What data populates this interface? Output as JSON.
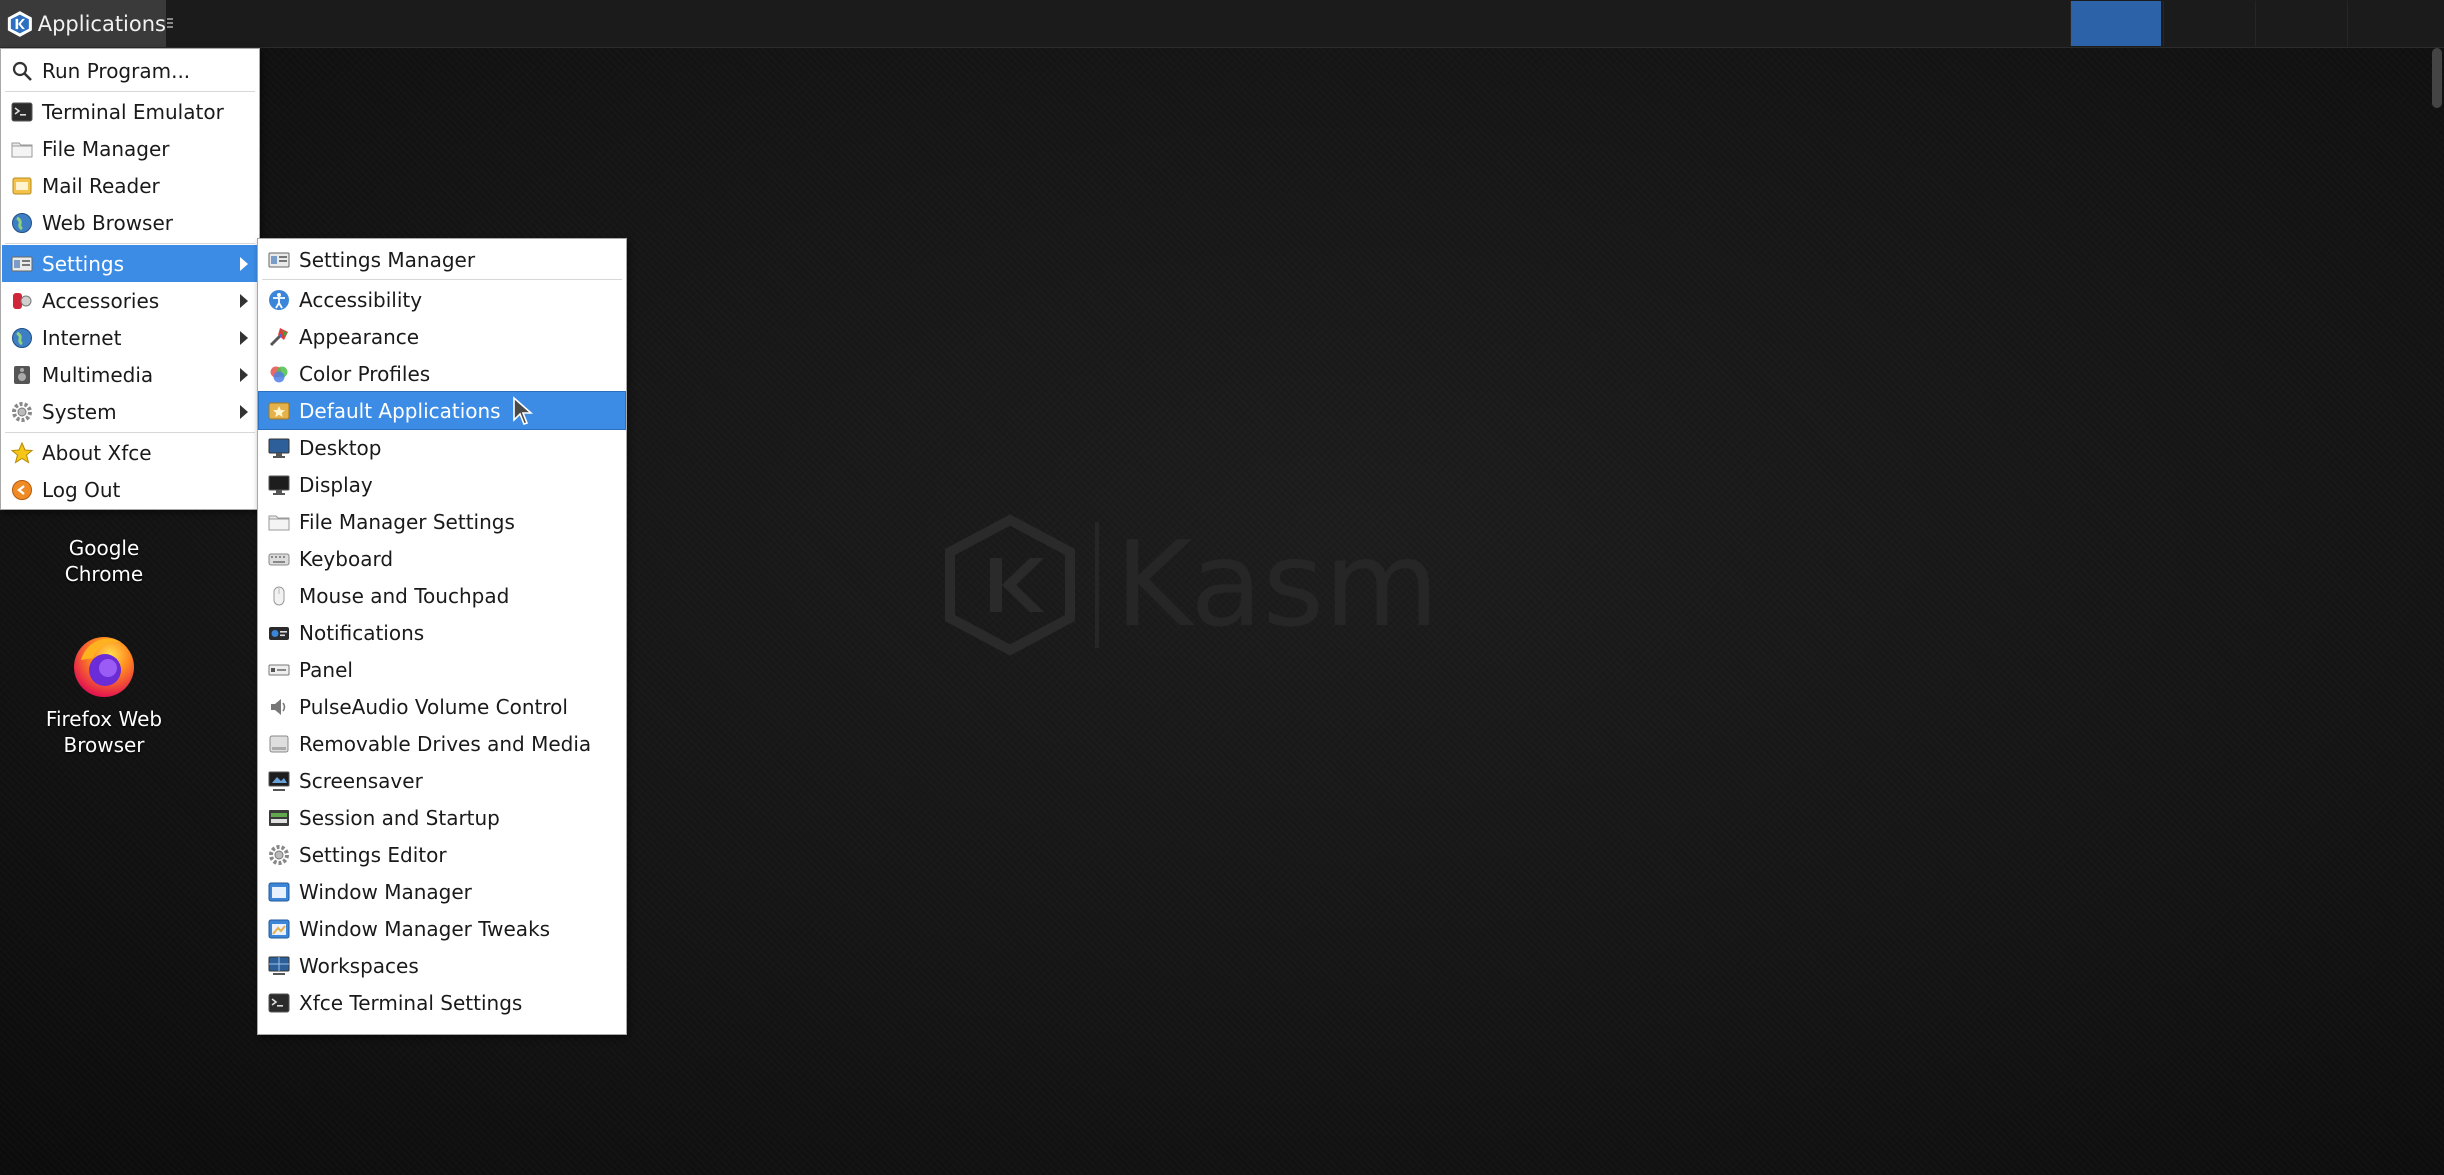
{
  "panel": {
    "apps_label": "Applications",
    "accent_color": "#2c63a8"
  },
  "desktop": {
    "chrome_label": "Google\nChrome",
    "firefox_label": "Firefox Web\nBrowser",
    "watermark": "Kasm"
  },
  "main_menu": {
    "items": [
      {
        "label": "Run Program...",
        "icon": "search-icon"
      },
      {
        "label": "Terminal Emulator",
        "icon": "terminal-icon"
      },
      {
        "label": "File Manager",
        "icon": "folder-icon"
      },
      {
        "label": "Mail Reader",
        "icon": "mail-icon"
      },
      {
        "label": "Web Browser",
        "icon": "globe-icon"
      },
      {
        "label": "Settings",
        "icon": "settings-icon"
      },
      {
        "label": "Accessories",
        "icon": "accessories-icon"
      },
      {
        "label": "Internet",
        "icon": "globe-icon"
      },
      {
        "label": "Multimedia",
        "icon": "multimedia-icon"
      },
      {
        "label": "System",
        "icon": "gear-icon"
      },
      {
        "label": "About Xfce",
        "icon": "star-icon"
      },
      {
        "label": "Log Out",
        "icon": "logout-icon"
      }
    ]
  },
  "settings_menu": {
    "items": [
      {
        "label": "Settings Manager",
        "icon": "settings-manager-icon"
      },
      {
        "label": "Accessibility",
        "icon": "accessibility-icon"
      },
      {
        "label": "Appearance",
        "icon": "appearance-icon"
      },
      {
        "label": "Color Profiles",
        "icon": "color-profiles-icon"
      },
      {
        "label": "Default Applications",
        "icon": "default-applications-icon"
      },
      {
        "label": "Desktop",
        "icon": "desktop-icon"
      },
      {
        "label": "Display",
        "icon": "display-icon"
      },
      {
        "label": "File Manager Settings",
        "icon": "folder-icon"
      },
      {
        "label": "Keyboard",
        "icon": "keyboard-icon"
      },
      {
        "label": "Mouse and Touchpad",
        "icon": "mouse-icon"
      },
      {
        "label": "Notifications",
        "icon": "notifications-icon"
      },
      {
        "label": "Panel",
        "icon": "panel-icon"
      },
      {
        "label": "PulseAudio Volume Control",
        "icon": "speaker-icon"
      },
      {
        "label": "Removable Drives and Media",
        "icon": "drive-icon"
      },
      {
        "label": "Screensaver",
        "icon": "screensaver-icon"
      },
      {
        "label": "Session and Startup",
        "icon": "session-icon"
      },
      {
        "label": "Settings Editor",
        "icon": "gear-icon"
      },
      {
        "label": "Window Manager",
        "icon": "window-manager-icon"
      },
      {
        "label": "Window Manager Tweaks",
        "icon": "window-tweaks-icon"
      },
      {
        "label": "Workspaces",
        "icon": "workspaces-icon"
      },
      {
        "label": "Xfce Terminal Settings",
        "icon": "terminal-icon"
      }
    ]
  },
  "state": {
    "active_menu": "Settings",
    "highlighted_item": "Default Applications"
  }
}
